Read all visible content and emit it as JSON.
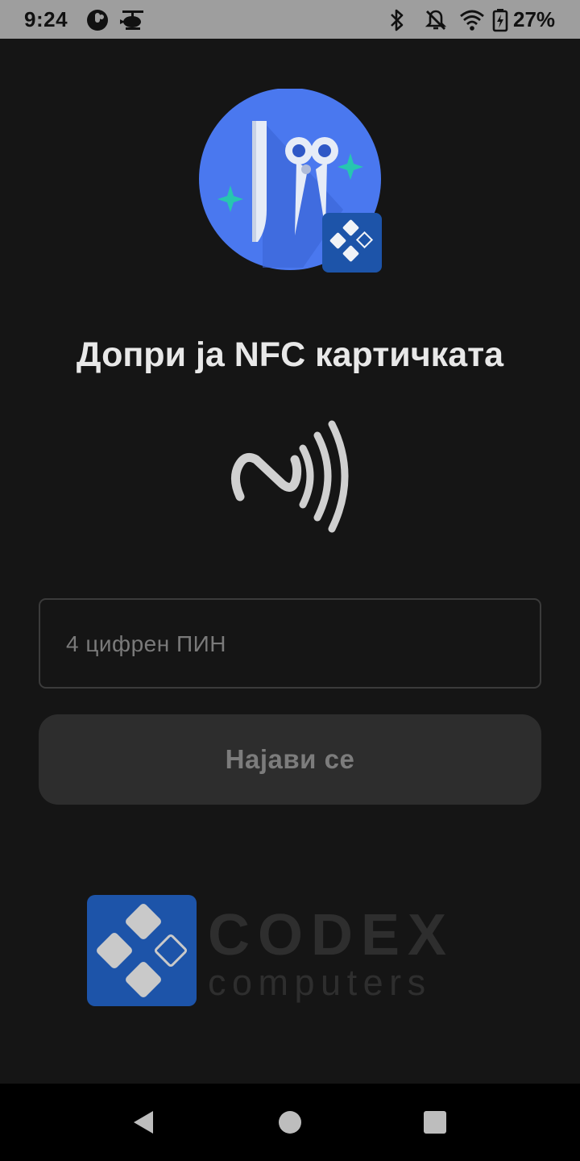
{
  "status_bar": {
    "time": "9:24",
    "battery_percent": "27%",
    "left_icons": [
      "pokeball-icon",
      "helicopter-icon"
    ],
    "right_icons": [
      "bluetooth-icon",
      "do-not-disturb-icon",
      "wifi-icon",
      "battery-charging-icon"
    ]
  },
  "app": {
    "logo_icon": "scissors-ruler-app-icon",
    "heading": "Допри ја NFC картичката",
    "nfc_icon": "nfc-icon",
    "pin": {
      "placeholder": "4 цифрен ПИН",
      "value": ""
    },
    "login_button_label": "Најави се",
    "footer_logo": {
      "icon": "codex-logo-icon",
      "line1": "CODEX",
      "line2": "computers"
    }
  },
  "nav_bar": {
    "items": [
      "back-icon",
      "home-icon",
      "recents-icon"
    ]
  },
  "colors": {
    "background": "#151515",
    "status_bar": "#9e9e9e",
    "logo_blue": "#4a78ef",
    "codex_blue": "#1d54a9",
    "accent_green": "#26c6b0"
  }
}
